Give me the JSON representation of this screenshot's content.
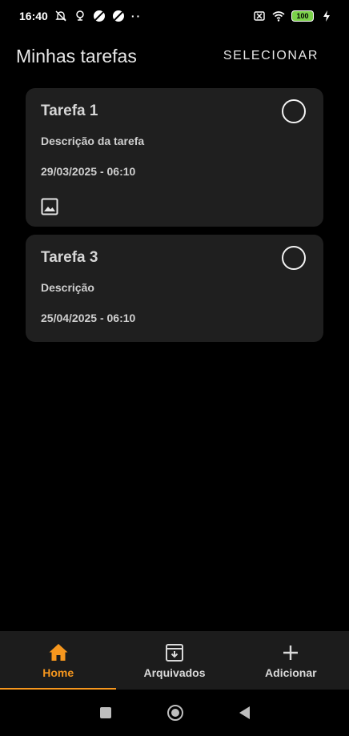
{
  "status_bar": {
    "time": "16:40",
    "battery": "100",
    "dots": "··"
  },
  "header": {
    "title": "Minhas tarefas",
    "select_label": "SELECIONAR"
  },
  "tasks": [
    {
      "title": "Tarefa 1",
      "description": "Descrição da tarefa",
      "date": "29/03/2025 - 06:10",
      "has_image": true,
      "completed": false
    },
    {
      "title": "Tarefa 3",
      "description": "Descrição",
      "date": "25/04/2025 - 06:10",
      "has_image": false,
      "completed": false
    }
  ],
  "bottom_nav": {
    "items": [
      {
        "label": "Home",
        "icon": "home-icon",
        "active": true
      },
      {
        "label": "Arquivados",
        "icon": "archive-icon",
        "active": false
      },
      {
        "label": "Adicionar",
        "icon": "plus-icon",
        "active": false
      }
    ]
  },
  "colors": {
    "accent": "#f6971e",
    "card_background": "#1f1f1f",
    "nav_background": "#1c1c1c",
    "background": "#000000"
  }
}
